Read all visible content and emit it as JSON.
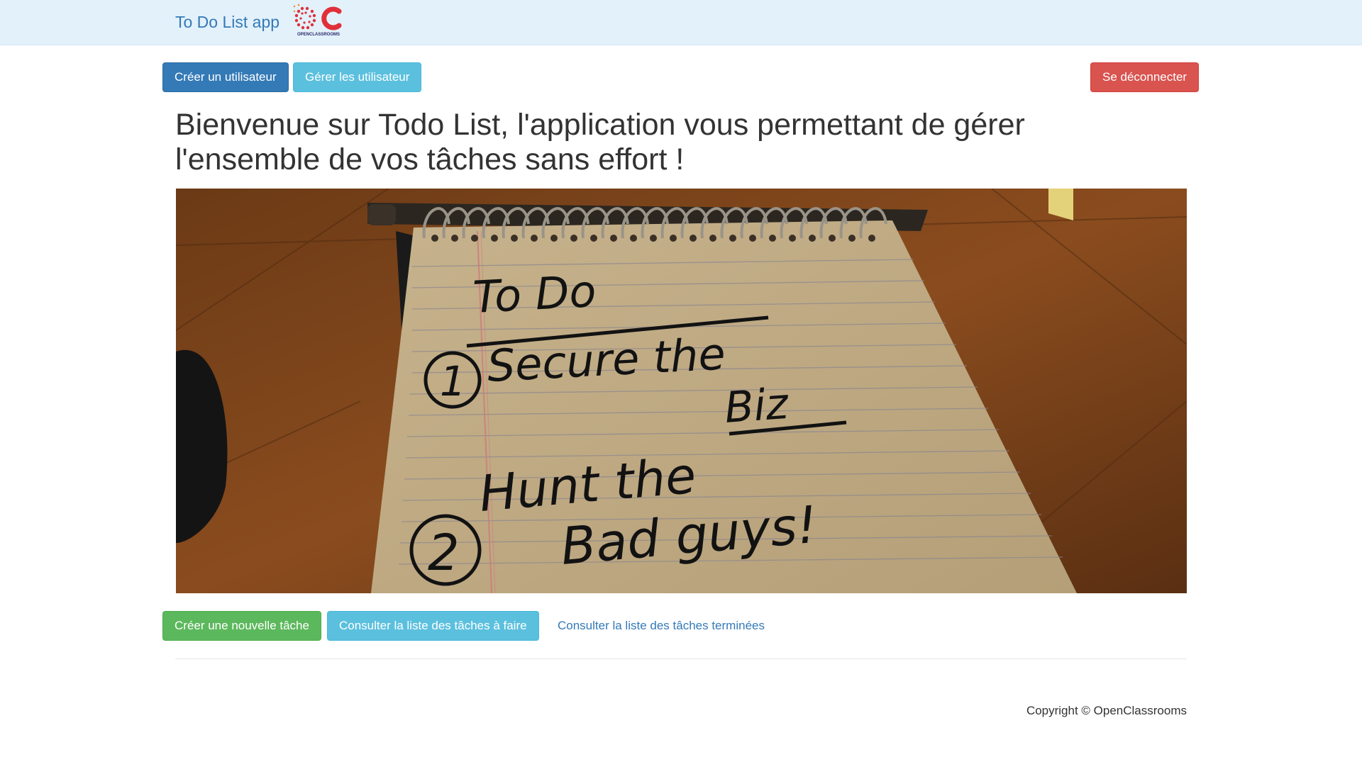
{
  "navbar": {
    "brand": "To Do List app",
    "logo_text": "OPENCLASSROOMS"
  },
  "actions": {
    "create_user": "Créer un utilisateur",
    "manage_users": "Gérer les utilisateur",
    "logout": "Se déconnecter"
  },
  "main": {
    "title": "Bienvenue sur Todo List, l'application vous permettant de gérer l'ensemble de vos tâches sans effort !",
    "hero_note": {
      "heading": "To Do",
      "item1_number": "1",
      "item1_text": "Secure the",
      "item1_text2": "Biz",
      "item2_text": "Hunt the",
      "item2_number": "2",
      "item2_text2": "Bad guys!"
    }
  },
  "tasks": {
    "create_task": "Créer une nouvelle tâche",
    "todo_list": "Consulter la liste des tâches à faire",
    "done_list": "Consulter la liste des tâches terminées"
  },
  "footer": {
    "copyright": "Copyright © OpenClassrooms"
  },
  "colors": {
    "primary": "#337ab7",
    "info": "#5bc0de",
    "danger": "#d9534f",
    "success": "#5cb85c",
    "navbar_bg": "#e3f1fb"
  }
}
